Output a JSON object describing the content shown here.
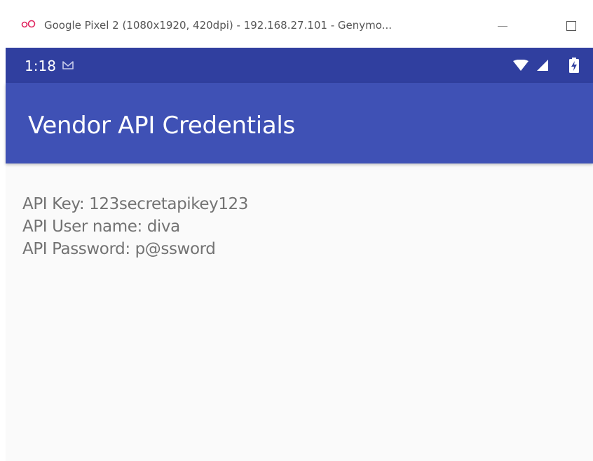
{
  "window": {
    "title": "Google Pixel 2 (1080x1920, 420dpi) - 192.168.27.101 - Genymo...",
    "app_icon": "genymotion-logo-icon",
    "controls": {
      "minimize_icon": "minimize-icon",
      "maximize_icon": "maximize-icon"
    }
  },
  "status_bar": {
    "time": "1:18",
    "icons": [
      "gmail-notification-icon",
      "wifi-icon",
      "signal-icon",
      "battery-charging-icon"
    ],
    "background": "#303f9f"
  },
  "app_bar": {
    "title": "Vendor API Credentials",
    "background": "#3f51b5"
  },
  "content": {
    "lines": [
      "API Key: 123secretapikey123",
      "API User name: diva",
      "API Password: p@ssword"
    ],
    "background": "#fafafa",
    "text_color": "#737373"
  }
}
